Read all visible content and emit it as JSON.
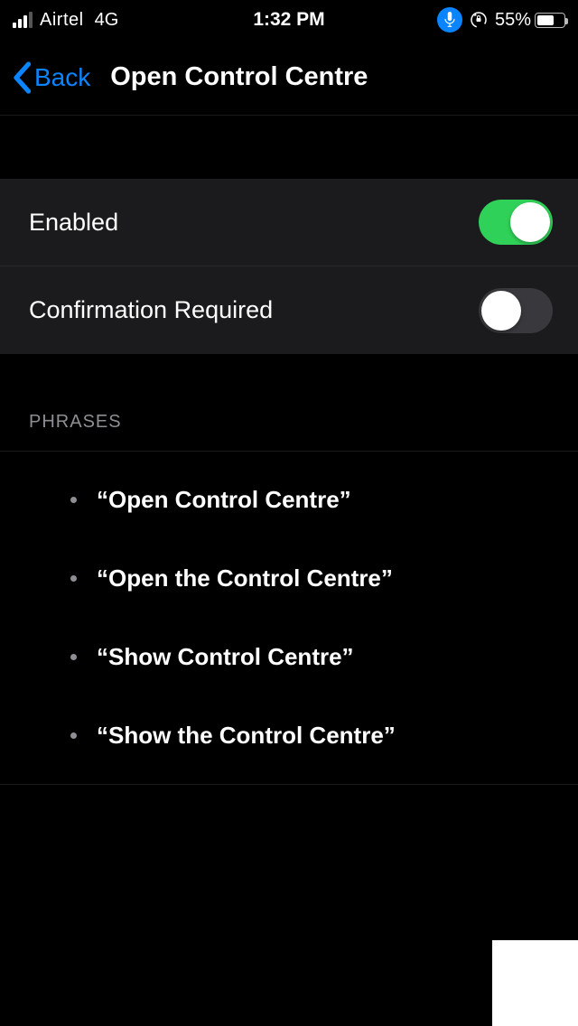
{
  "status": {
    "carrier": "Airtel",
    "network": "4G",
    "time": "1:32 PM",
    "battery_pct": "55%"
  },
  "nav": {
    "back_label": "Back",
    "title": "Open Control Centre"
  },
  "settings": {
    "enabled_label": "Enabled",
    "enabled_on": true,
    "confirmation_label": "Confirmation Required",
    "confirmation_on": false
  },
  "phrases_header": "PHRASES",
  "phrases": [
    "“Open Control Centre”",
    "“Open the Control Centre”",
    "“Show Control Centre”",
    "“Show the Control Centre”"
  ]
}
